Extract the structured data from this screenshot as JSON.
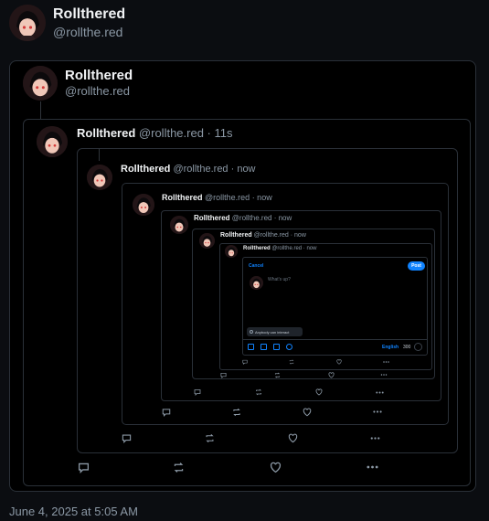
{
  "post": {
    "author_name": "Rollthered",
    "author_handle": "@rollthe.red",
    "timestamp": "June 4, 2025 at 5:05 AM"
  },
  "quote1": {
    "name": "Rollthered",
    "handle": "@rollthe.red"
  },
  "quote2": {
    "name": "Rollthered",
    "handle_time": "@rollthe.red · 11s"
  },
  "quote3": {
    "name": "Rollthered",
    "handle_time": "@rollthe.red · now"
  },
  "quote4": {
    "name": "Rollthered",
    "handle_time": "@rollthe.red · now"
  },
  "quote5": {
    "name": "Rollthered",
    "handle_time": "@rollthe.red · now"
  },
  "quote6": {
    "name": "Rollthered",
    "handle_time": "@rollthe.red · now"
  },
  "quote7": {
    "name": "Rollthered",
    "handle_time": "@rollthe.red · now"
  },
  "composer": {
    "cancel_label": "Cancel",
    "post_label": "Post",
    "placeholder": "What's up?",
    "interact_label": "Anybody can interact",
    "language": "English",
    "char_count": "300"
  },
  "colors": {
    "accent": "#1083fe",
    "background": "#000000",
    "border": "#2a3038",
    "muted": "#8b98a5"
  }
}
